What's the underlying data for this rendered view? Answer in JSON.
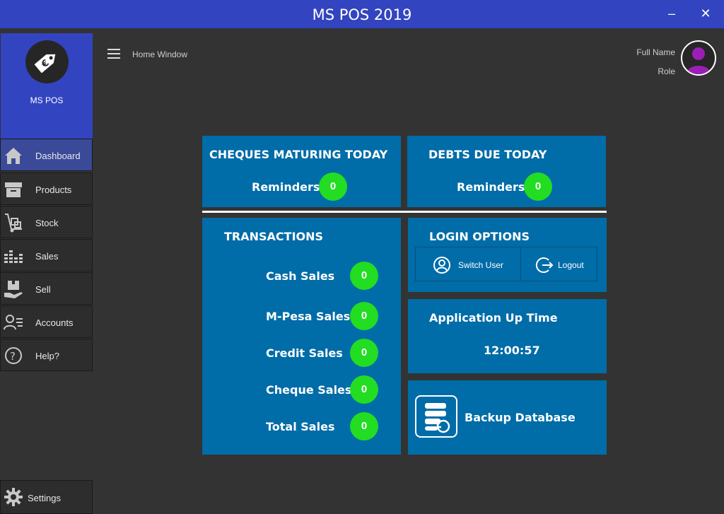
{
  "window": {
    "title": "MS POS 2019",
    "minimize": "–",
    "close": "✕"
  },
  "brand": {
    "name": "MS POS",
    "logo_icon": "price-tag-euro-icon"
  },
  "sidebar": {
    "items": [
      {
        "label": "Dashboard",
        "icon": "home-icon"
      },
      {
        "label": "Products",
        "icon": "box-icon"
      },
      {
        "label": "Stock",
        "icon": "hand-truck-icon"
      },
      {
        "label": "Sales",
        "icon": "bar-list-icon"
      },
      {
        "label": "Sell",
        "icon": "hand-box-icon"
      },
      {
        "label": "Accounts",
        "icon": "user-list-icon"
      },
      {
        "label": "Help?",
        "icon": "help-icon"
      }
    ],
    "settings": "Settings"
  },
  "header": {
    "breadcrumb": "Home Window",
    "user_name": "Full Name",
    "user_role": "Role"
  },
  "cheques": {
    "title": "CHEQUES MATURING TODAY",
    "label": "Reminders",
    "count": "0"
  },
  "debts": {
    "title": "DEBTS DUE TODAY",
    "label": "Reminders",
    "count": "0"
  },
  "transactions": {
    "title": "TRANSACTIONS",
    "rows": [
      {
        "label": "Cash Sales",
        "value": "0"
      },
      {
        "label": "M-Pesa Sales",
        "value": "0"
      },
      {
        "label": "Credit Sales",
        "value": "0"
      },
      {
        "label": "Cheque Sales",
        "value": "0"
      },
      {
        "label": "Total Sales",
        "value": "0"
      }
    ]
  },
  "login": {
    "title": "LOGIN OPTIONS",
    "switch_user": "Switch User",
    "logout": "Logout"
  },
  "uptime": {
    "title": "Application Up Time",
    "value": "12:00:57"
  },
  "backup": {
    "label": "Backup Database"
  },
  "colors": {
    "titlebar": "#3344c0",
    "panel": "#006ca8",
    "badge": "#22dd22",
    "background": "#333333",
    "avatar": "#9b1fb5"
  }
}
